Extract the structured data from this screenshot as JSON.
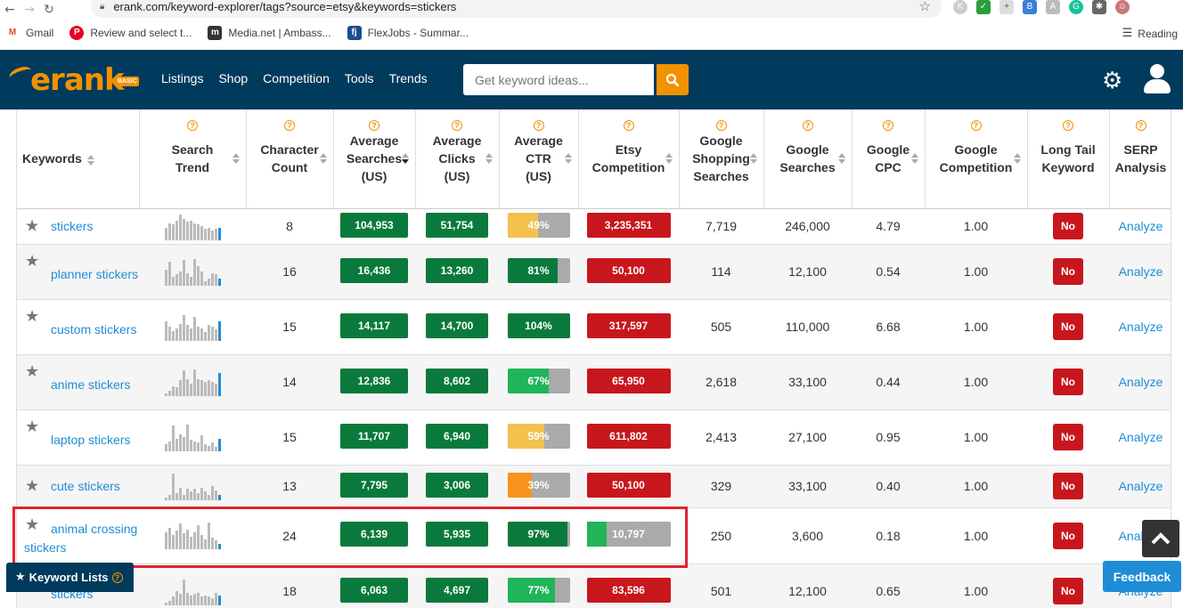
{
  "browser": {
    "url": "erank.com/keyword-explorer/tags?source=etsy&keywords=stickers",
    "bookmarks": [
      {
        "label": "Gmail",
        "icon": "gmail-icon",
        "color": "#ea4335",
        "glyph": "M"
      },
      {
        "label": "Review and select t...",
        "icon": "pinterest-icon",
        "color": "#e60023",
        "glyph": "P"
      },
      {
        "label": "Media.net | Ambass...",
        "icon": "medianet-icon",
        "color": "#333333",
        "glyph": "m"
      },
      {
        "label": "FlexJobs - Summar...",
        "icon": "flexjobs-icon",
        "color": "#1a4d8c",
        "glyph": "fj"
      }
    ],
    "reading_label": "Reading"
  },
  "site": {
    "logo_text": "erank",
    "logo_badge": "BASIC",
    "nav": [
      "Listings",
      "Shop",
      "Competition",
      "Tools",
      "Trends"
    ],
    "search_placeholder": "Get keyword ideas...",
    "colors": {
      "header": "#003a5c",
      "accent": "#f39200",
      "link": "#1f8dd6"
    }
  },
  "table": {
    "headers": {
      "keywords": "Keywords",
      "search_trend": "Search Trend",
      "char_count": "Character Count",
      "avg_searches": "Average Searches (US)",
      "avg_clicks": "Average Clicks (US)",
      "avg_ctr": "Average CTR (US)",
      "etsy_comp": "Etsy Competition",
      "google_shopping": "Google Shopping Searches",
      "google_searches": "Google Searches",
      "google_cpc": "Google CPC",
      "google_comp": "Google Competition",
      "long_tail": "Long Tail Keyword",
      "serp": "SERP Analysis"
    },
    "rows": [
      {
        "keyword": "stickers",
        "chars": "8",
        "searches": "104,953",
        "clicks": "51,754",
        "ctr": "49%",
        "ctr_value": 0.49,
        "ctr_color": "#f2c14e",
        "etsy": "3,235,351",
        "etsy_low": false,
        "shopping": "7,719",
        "google": "246,000",
        "cpc": "4.79",
        "gcomp": "1.00",
        "long_tail": "No",
        "serp": "Analyze",
        "trend": [
          0.45,
          0.6,
          0.55,
          0.7,
          0.9,
          0.75,
          0.65,
          0.7,
          0.6,
          0.55,
          0.5,
          0.4,
          0.45,
          0.35,
          0.4,
          0.45
        ]
      },
      {
        "keyword": "planner stickers",
        "chars": "16",
        "searches": "16,436",
        "clicks": "13,260",
        "ctr": "81%",
        "ctr_value": 0.81,
        "ctr_color": "#0a7a3c",
        "etsy": "50,100",
        "etsy_low": false,
        "shopping": "114",
        "google": "12,100",
        "cpc": "0.54",
        "gcomp": "1.00",
        "long_tail": "No",
        "serp": "Analyze",
        "trend": [
          0.55,
          0.85,
          0.3,
          0.4,
          0.5,
          0.9,
          0.45,
          0.3,
          0.95,
          0.7,
          0.5,
          0.15,
          0.25,
          0.45,
          0.4,
          0.25
        ]
      },
      {
        "keyword": "custom stickers",
        "chars": "15",
        "searches": "14,117",
        "clicks": "14,700",
        "ctr": "104%",
        "ctr_value": 1.0,
        "ctr_color": "#0a7a3c",
        "etsy": "317,597",
        "etsy_low": false,
        "shopping": "505",
        "google": "110,000",
        "cpc": "6.68",
        "gcomp": "1.00",
        "long_tail": "No",
        "serp": "Analyze",
        "trend": [
          0.7,
          0.5,
          0.35,
          0.45,
          0.6,
          0.9,
          0.55,
          0.45,
          0.85,
          0.5,
          0.45,
          0.3,
          0.55,
          0.5,
          0.4,
          0.7
        ]
      },
      {
        "keyword": "anime stickers",
        "chars": "14",
        "searches": "12,836",
        "clicks": "8,602",
        "ctr": "67%",
        "ctr_value": 0.67,
        "ctr_color": "#20b559",
        "etsy": "65,950",
        "etsy_low": false,
        "shopping": "2,618",
        "google": "33,100",
        "cpc": "0.44",
        "gcomp": "1.00",
        "long_tail": "No",
        "serp": "Analyze",
        "trend": [
          0.1,
          0.2,
          0.35,
          0.3,
          0.55,
          0.9,
          0.6,
          0.45,
          0.95,
          0.6,
          0.55,
          0.5,
          0.55,
          0.5,
          0.45,
          0.8
        ]
      },
      {
        "keyword": "laptop stickers",
        "chars": "15",
        "searches": "11,707",
        "clicks": "6,940",
        "ctr": "59%",
        "ctr_value": 0.59,
        "ctr_color": "#f2c14e",
        "etsy": "611,802",
        "etsy_low": false,
        "shopping": "2,413",
        "google": "27,100",
        "cpc": "0.95",
        "gcomp": "1.00",
        "long_tail": "No",
        "serp": "Analyze",
        "trend": [
          0.25,
          0.35,
          0.9,
          0.45,
          0.6,
          0.5,
          0.95,
          0.4,
          0.35,
          0.3,
          0.55,
          0.25,
          0.2,
          0.3,
          0.15,
          0.45
        ]
      },
      {
        "keyword": "cute stickers",
        "chars": "13",
        "searches": "7,795",
        "clicks": "3,006",
        "ctr": "39%",
        "ctr_value": 0.39,
        "ctr_color": "#f7931e",
        "etsy": "50,100",
        "etsy_low": false,
        "shopping": "329",
        "google": "33,100",
        "cpc": "0.40",
        "gcomp": "1.00",
        "long_tail": "No",
        "serp": "Analyze",
        "trend": [
          0.1,
          0.2,
          0.95,
          0.25,
          0.45,
          0.2,
          0.4,
          0.3,
          0.4,
          0.25,
          0.45,
          0.3,
          0.2,
          0.5,
          0.35,
          0.2
        ]
      },
      {
        "keyword": "animal crossing stickers",
        "chars": "24",
        "searches": "6,139",
        "clicks": "5,935",
        "ctr": "97%",
        "ctr_value": 0.97,
        "ctr_color": "#0a7a3c",
        "etsy": "10,797",
        "etsy_low": true,
        "shopping": "250",
        "google": "3,600",
        "cpc": "0.18",
        "gcomp": "1.00",
        "long_tail": "No",
        "serp": "Analyze",
        "trend": [
          0.6,
          0.75,
          0.5,
          0.65,
          0.9,
          0.55,
          0.7,
          0.45,
          0.6,
          0.85,
          0.5,
          0.35,
          0.95,
          0.4,
          0.3,
          0.2
        ]
      },
      {
        "keyword": "stickers",
        "chars": "18",
        "searches": "6,063",
        "clicks": "4,697",
        "ctr": "77%",
        "ctr_value": 0.77,
        "ctr_color": "#20b559",
        "etsy": "83,596",
        "etsy_low": false,
        "shopping": "501",
        "google": "12,100",
        "cpc": "0.65",
        "gcomp": "1.00",
        "long_tail": "No",
        "serp": "Analyze",
        "trend": [
          0.1,
          0.15,
          0.3,
          0.5,
          0.4,
          0.9,
          0.45,
          0.35,
          0.4,
          0.45,
          0.3,
          0.35,
          0.3,
          0.25,
          0.45,
          0.35
        ]
      }
    ]
  },
  "widgets": {
    "keyword_lists": "Keyword Lists",
    "feedback": "Feedback"
  }
}
